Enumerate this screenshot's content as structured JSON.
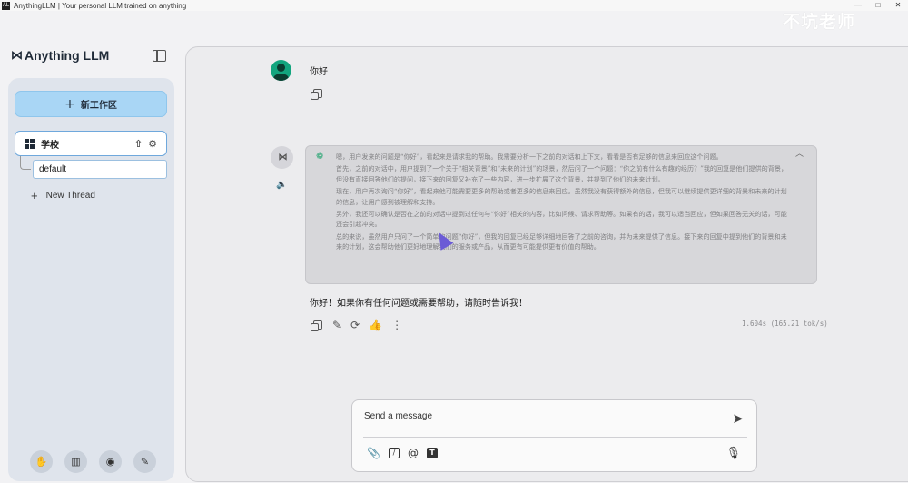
{
  "window": {
    "title": "AnythingLLM | Your personal LLM trained on anything",
    "app_icon": "AL",
    "controls": [
      "—",
      "□",
      "✕"
    ]
  },
  "watermark": "不坑老师",
  "sidebar": {
    "logo_mark": "⋈",
    "logo_text": "Anything LLM",
    "new_workspace_label": "新工作区",
    "workspace": {
      "name": "学校",
      "upload_icon": "⇧",
      "settings_icon": "⚙"
    },
    "thread": "default",
    "new_thread_label": "New Thread",
    "footer_icons": [
      "community-icon",
      "docs-icon",
      "discord-icon",
      "settings-wrench-icon"
    ]
  },
  "chat": {
    "user_message": "你好",
    "thinking": [
      "嗯，用户发来的问题是“你好”，看起来是请求我的帮助。我需要分析一下之前的对话和上下文，看看是否有足够的信息来回应这个问题。",
      "首先，之前的对话中，用户提到了一个关于“相关背景”和“未来的计划”的场景，然后问了一个问题：“你之前有什么有趣的经历？”我的回复是他们提供的背景，但没有直接回答他们的提问，接下来的回复又补充了一些内容，进一步扩展了这个背景，并提到了他们的未来计划。",
      "现在，用户再次询问“你好”，看起来他可能需要更多的帮助或者更多的信息来回应。虽然我没有获得额外的信息，但我可以继续提供更详细的背景和未来的计划的信息，让用户感到被理解和支持。",
      "另外，我还可以确认是否在之前的对话中提到过任何与“你好”相关的内容，比如问候、请求帮助等。如果有的话，我可以适当回应，但如果回答无关的话，可能还会引起冲突。",
      "总的来说，虽然用户只问了一个简单的问题“你好”，但我的回复已经足够详细地回答了之前的咨询，并为未来提供了信息。接下来的回复中提到他们的背景和未来的计划，这会帮助他们更好地理解我们的服务或产品，从而更有可能提供更有价值的帮助。"
    ],
    "answer": "你好！如果你有任何问题或需要帮助，请随时告诉我！",
    "metrics": "1.604s (165.21 tok/s)"
  },
  "composer": {
    "placeholder": "Send a message"
  },
  "colors": {
    "accent": "#a9d6f5",
    "user_avatar": "#13a57e",
    "sidebar_bg": "#dfe4ec"
  }
}
